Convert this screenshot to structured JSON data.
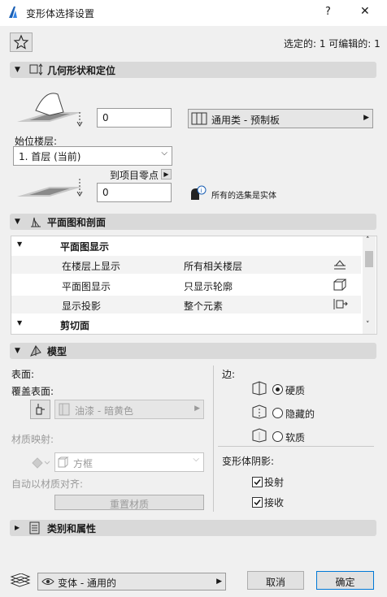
{
  "window": {
    "title": "变形体选择设置",
    "help": "?",
    "close": "✕"
  },
  "header": {
    "selection_info": "选定的: 1 可编辑的: 1"
  },
  "geometry": {
    "title": "几何形状和定位",
    "top_offset": "0",
    "home_story_label": "始位楼层:",
    "home_story_value": "1. 首层 (当前)",
    "project_zero_label": "到项目零点",
    "bottom_offset": "0",
    "building_material": "通用类 - 预制板",
    "solid_note": "所有的选集是实体"
  },
  "plan": {
    "title": "平面图和剖面",
    "group1": "平面图显示",
    "rows": [
      {
        "label": "在楼层上显示",
        "value": "所有相关楼层"
      },
      {
        "label": "平面图显示",
        "value": "只显示轮廓"
      },
      {
        "label": "显示投影",
        "value": "整个元素"
      }
    ],
    "group2": "剪切面"
  },
  "model": {
    "title": "模型",
    "surface_label": "表面:",
    "override_label": "覆盖表面:",
    "surface_value": "油漆 - 暗黄色",
    "texture_label": "材质映射:",
    "texture_value": "方框",
    "auto_align_label": "自动以材质对齐:",
    "reset_button": "重置材质",
    "edges_label": "边:",
    "edge_options": [
      "硬质",
      "隐藏的",
      "软质"
    ],
    "shadow_label": "变形体阴影:",
    "cast_label": "投射",
    "receive_label": "接收"
  },
  "classification": {
    "title": "类别和属性"
  },
  "footer": {
    "layer_value": "变体 - 通用的",
    "cancel": "取消",
    "ok": "确定"
  }
}
